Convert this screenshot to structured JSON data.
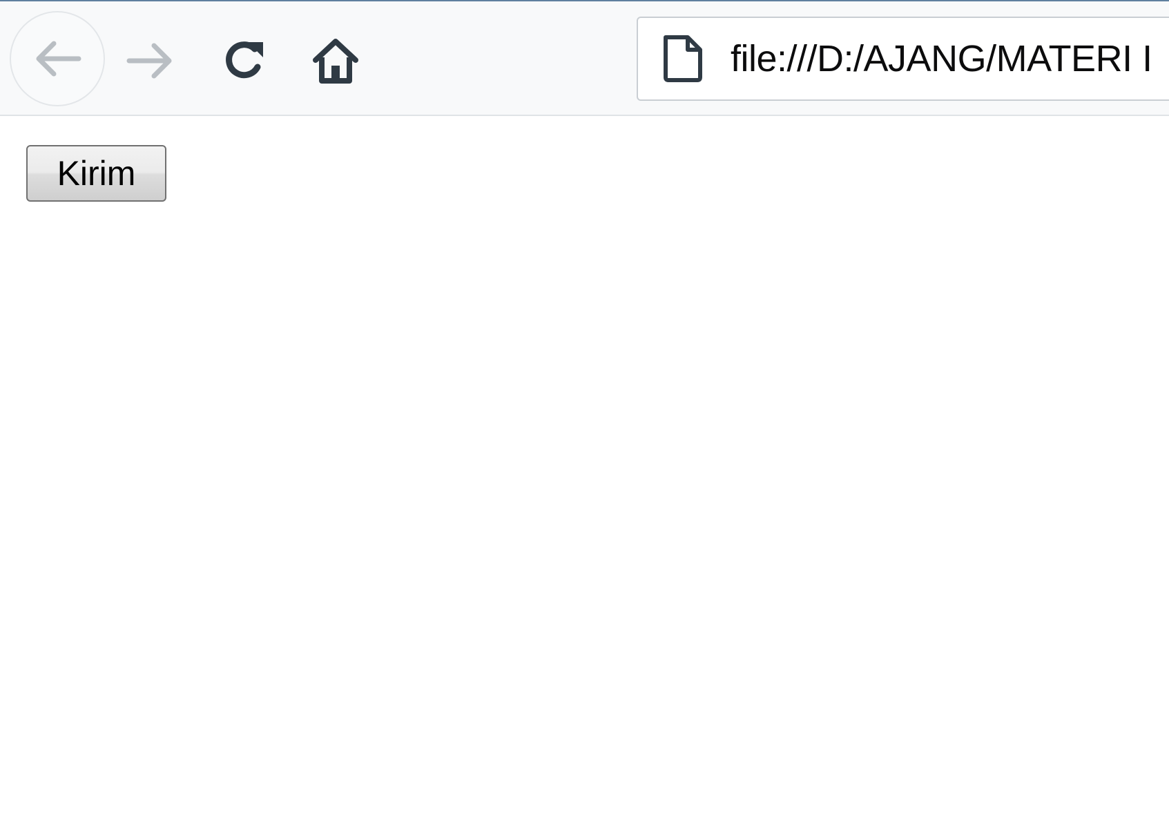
{
  "browser": {
    "toolbar": {
      "back_icon": "arrow-left-icon",
      "forward_icon": "arrow-right-icon",
      "reload_icon": "reload-icon",
      "home_icon": "home-icon"
    },
    "address_bar": {
      "page_icon": "page-icon",
      "url": "file:///D:/AJANG/MATERI I"
    }
  },
  "page": {
    "submit_button_label": "Kirim"
  },
  "colors": {
    "toolbar_bg": "#f8f9fa",
    "icon_active": "#2f3a44",
    "icon_disabled": "#b9bec3"
  }
}
